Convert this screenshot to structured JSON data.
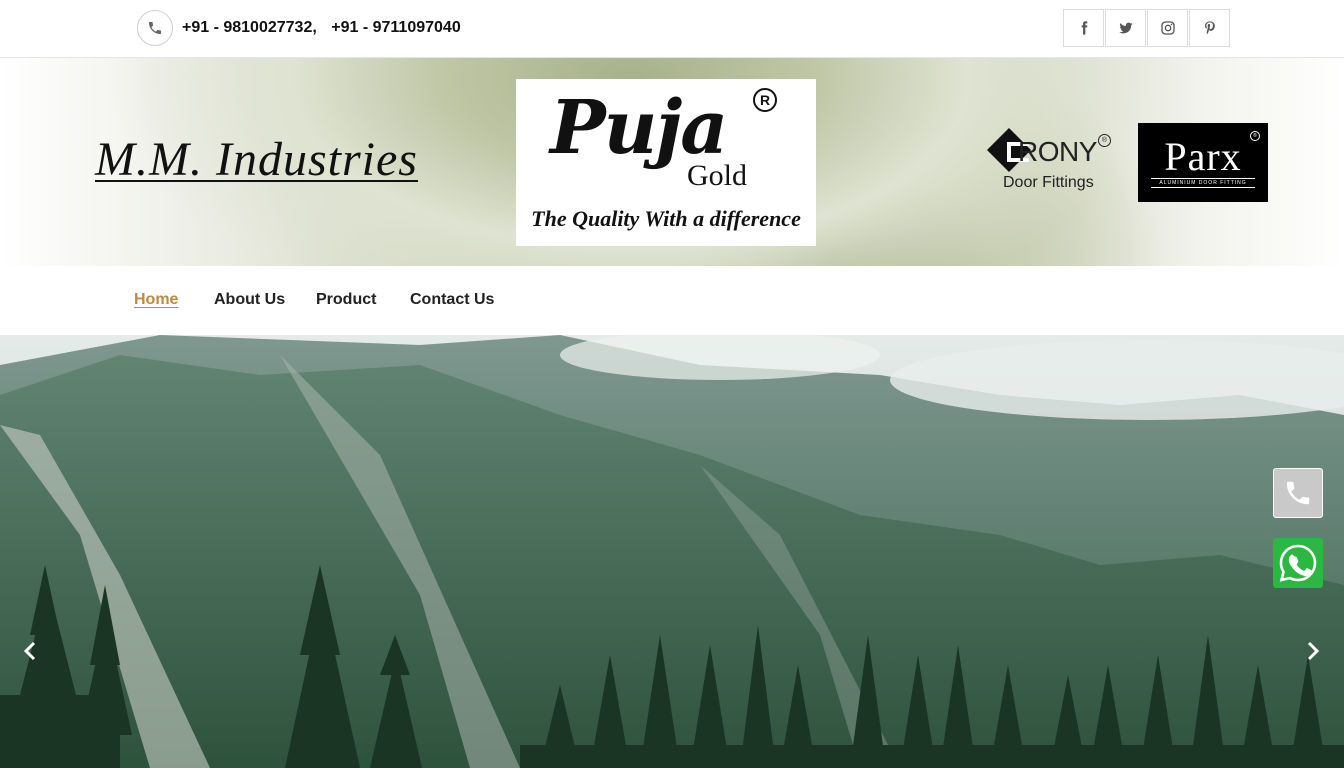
{
  "topbar": {
    "phone_icon": "phone-icon",
    "phones": [
      "+91 - 9810027732,",
      "+91 - 9711097040"
    ],
    "social": [
      {
        "name": "facebook",
        "glyph": "f"
      },
      {
        "name": "twitter",
        "glyph": "t"
      },
      {
        "name": "instagram",
        "glyph": "i"
      },
      {
        "name": "pinterest",
        "glyph": "p"
      }
    ]
  },
  "header": {
    "company_name": "M.M. Industries",
    "brand_logo": {
      "word": "Puja",
      "registered": "R",
      "sub": "Gold",
      "tagline": "The Quality With a difference"
    },
    "partner_logos": [
      {
        "word": "RONY",
        "registered": "®",
        "sub": "Door Fittings"
      },
      {
        "word": "Parx",
        "registered": "®",
        "sub": "ALUMINIUM DOOR FITTING"
      }
    ]
  },
  "nav": {
    "items": [
      {
        "label": "Home",
        "active": true
      },
      {
        "label": "About Us",
        "active": false
      },
      {
        "label": "Product",
        "active": false
      },
      {
        "label": "Contact Us",
        "active": false
      }
    ],
    "accent": "#c08a3e"
  },
  "hero": {
    "image": "mountain-forest-landscape",
    "prev_icon": "chevron-left-icon",
    "next_icon": "chevron-right-icon"
  },
  "floating": {
    "call_icon": "phone-icon",
    "whatsapp_icon": "whatsapp-icon",
    "whatsapp_color": "#2bb741"
  }
}
